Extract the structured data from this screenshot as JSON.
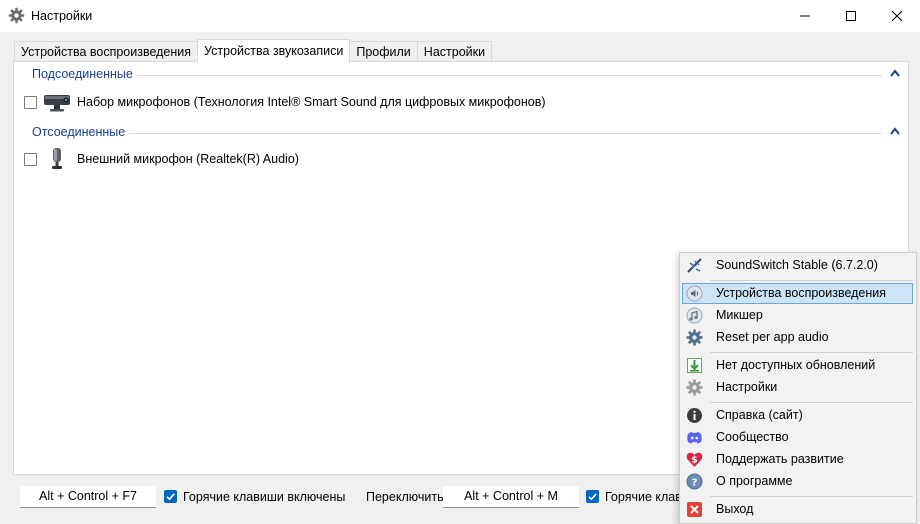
{
  "window": {
    "title": "Настройки"
  },
  "tabs": [
    {
      "label": "Устройства воспроизведения"
    },
    {
      "label": "Устройства звукозаписи"
    },
    {
      "label": "Профили"
    },
    {
      "label": "Настройки"
    }
  ],
  "groups": {
    "connected": {
      "title": "Подсоединенные",
      "devices": [
        {
          "label": "Набор микрофонов (Технология Intel® Smart Sound для цифровых микрофонов)",
          "checked": false
        }
      ]
    },
    "disconnected": {
      "title": "Отсоединенные",
      "devices": [
        {
          "label": "Внешний микрофон (Realtek(R) Audio)",
          "checked": false
        }
      ]
    }
  },
  "bottom": {
    "hotkey1": "Alt + Control + F7",
    "hotkeys_enabled_label": "Горячие клавиши включены",
    "switch_label": "Переключить",
    "hotkey2": "Alt + Control + M",
    "hotkeys_enabled_label_2": "Горячие клав"
  },
  "menu": {
    "items": [
      {
        "label": "SoundSwitch Stable (6.7.2.0)",
        "icon": "soundswitch-icon"
      },
      {
        "label": "Устройства воспроизведения",
        "icon": "speaker-icon",
        "highlighted": true
      },
      {
        "label": "Микшер",
        "icon": "mixer-icon"
      },
      {
        "label": "Reset per app audio",
        "icon": "gear-icon"
      },
      {
        "label": "Нет доступных обновлений",
        "icon": "update-icon"
      },
      {
        "label": "Настройки",
        "icon": "settings-gear-icon"
      },
      {
        "label": "Справка (сайт)",
        "icon": "info-icon"
      },
      {
        "label": "Сообщество",
        "icon": "discord-icon"
      },
      {
        "label": "Поддержать развитие",
        "icon": "heart-dollar-icon"
      },
      {
        "label": "О программе",
        "icon": "help-icon"
      },
      {
        "label": "Выход",
        "icon": "exit-icon"
      }
    ]
  },
  "colors": {
    "accent": "#0067c0",
    "group_title": "#1a3f8f",
    "menu_highlight": "#cce4f7"
  }
}
